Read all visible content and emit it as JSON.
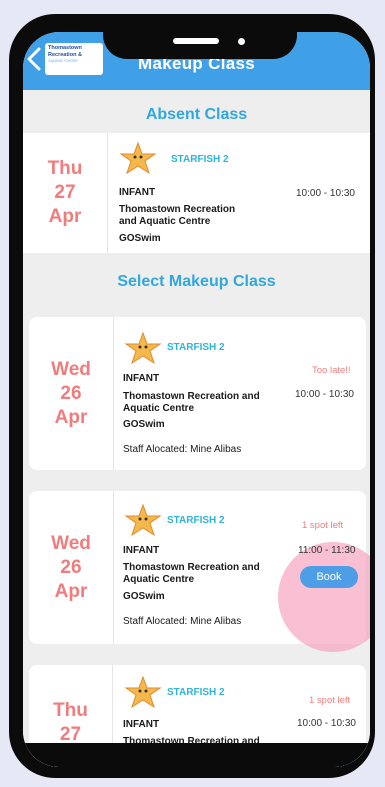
{
  "header": {
    "title": "Makeup Class",
    "logo_line1": "Thomastown",
    "logo_line2": "Recreation &",
    "logo_line3": "Aquatic Centre"
  },
  "absent": {
    "section_title": "Absent Class",
    "day": "Thu",
    "date": "27",
    "month": "Apr",
    "level": "STARFISH 2",
    "type": "INFANT",
    "venue_line1": "Thomastown Recreation",
    "venue_line2": "and Aquatic Centre",
    "provider": "GOSwim",
    "time": "10:00 - 10:30"
  },
  "makeup": {
    "section_title": "Select Makeup Class",
    "classes": [
      {
        "day": "Wed",
        "date": "26",
        "month": "Apr",
        "level": "STARFISH 2",
        "type": "INFANT",
        "venue_line1": "Thomastown Recreation and",
        "venue_line2": "Aquatic Centre",
        "provider": "GOSwim",
        "staff": "Staff Alocated: Mine Alibas",
        "status": "Too late!!",
        "time": "10:00 - 10:30"
      },
      {
        "day": "Wed",
        "date": "26",
        "month": "Apr",
        "level": "STARFISH 2",
        "type": "INFANT",
        "venue_line1": "Thomastown Recreation and",
        "venue_line2": "Aquatic Centre",
        "provider": "GOSwim",
        "staff": "Staff Alocated: Mine Alibas",
        "status": "1 spot left",
        "time": "11:00 - 11:30",
        "button": "Book"
      },
      {
        "day": "Thu",
        "date": "27",
        "level": "STARFISH 2",
        "type": "INFANT",
        "venue_line1": "Thomastown Recreation and",
        "status": "1 spot left",
        "time": "10:00 - 10:30"
      }
    ]
  },
  "colors": {
    "header": "#3fa0e8",
    "accent": "#30a8de",
    "date": "#f07d7d",
    "button": "#4d9ee6"
  }
}
